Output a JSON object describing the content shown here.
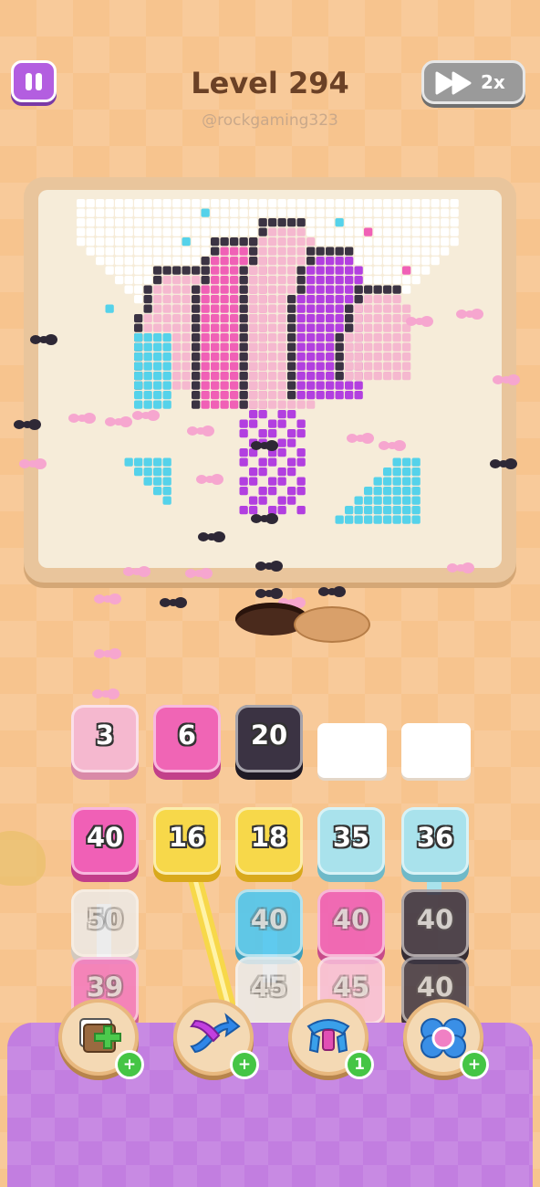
{
  "header": {
    "title": "Level 294",
    "handle": "@rockgaming323",
    "speed_label": "2x"
  },
  "collector_slots": [
    {
      "value": "3",
      "color": "#f5b8cf",
      "shade": "#d98aa8"
    },
    {
      "value": "6",
      "color": "#f065b5",
      "shade": "#c2408a"
    },
    {
      "value": "20",
      "color": "#3b3343",
      "shade": "#1f1a25"
    },
    {
      "value": "",
      "color": "#ffffff",
      "shade": "#e3d6c8"
    },
    {
      "value": "",
      "color": "#ffffff",
      "shade": "#e3d6c8"
    }
  ],
  "grid": {
    "row1": [
      {
        "value": "40",
        "color": "#f060b6",
        "shade": "#c23e8a"
      },
      {
        "value": "16",
        "color": "#f7d84a",
        "shade": "#d9a91c"
      },
      {
        "value": "18",
        "color": "#f7d84a",
        "shade": "#d9a91c"
      },
      {
        "value": "35",
        "color": "#a9e2ec",
        "shade": "#6fb9c8"
      },
      {
        "value": "36",
        "color": "#a9e2ec",
        "shade": "#6fb9c8"
      }
    ],
    "row2": [
      {
        "value": "50",
        "color": "#ececec",
        "shade": "#c9c9c9"
      },
      {
        "value": "40",
        "color": "#50c7ef",
        "shade": "#2a9bc2"
      },
      {
        "value": "40",
        "color": "#f060b6",
        "shade": "#c23e8a"
      },
      {
        "value": "40",
        "color": "#3e3744",
        "shade": "#221c28"
      }
    ],
    "row3": [
      {
        "value": "39",
        "color": "#f47ac0",
        "shade": "#c94e92"
      },
      {
        "value": "45",
        "color": "#ececec",
        "shade": "#c9c9c9"
      },
      {
        "value": "45",
        "color": "#f9c1dc",
        "shade": "#dd93b5"
      },
      {
        "value": "40",
        "color": "#3e3744",
        "shade": "#221c28"
      }
    ]
  },
  "powerups": [
    {
      "name": "add-slot-icon",
      "badge": "+"
    },
    {
      "name": "shuffle-icon",
      "badge": "+"
    },
    {
      "name": "magnet-icon",
      "badge": "1"
    },
    {
      "name": "flower-icon",
      "badge": "+"
    }
  ],
  "colors": {
    "pause": "#b35ee0",
    "pink": "#f060b6",
    "light_pink": "#f5b8cf",
    "purple": "#b23fe0",
    "cyan": "#55d2ea",
    "dark": "#3b3343",
    "white_pixel": "#ffffff",
    "panel": "#c27ee0"
  }
}
